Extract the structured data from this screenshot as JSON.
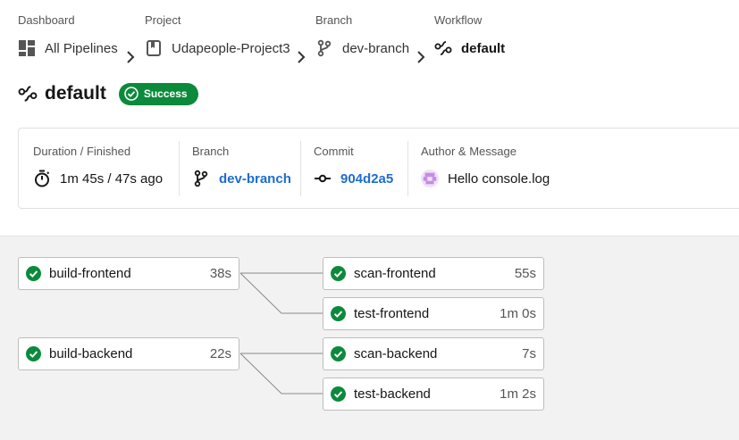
{
  "breadcrumb": {
    "dashboard": {
      "label": "Dashboard",
      "value": "All Pipelines"
    },
    "project": {
      "label": "Project",
      "value": "Udapeople-Project3"
    },
    "branch": {
      "label": "Branch",
      "value": "dev-branch"
    },
    "workflow": {
      "label": "Workflow",
      "value": "default"
    }
  },
  "title": {
    "name": "default",
    "status": "Success"
  },
  "info": {
    "duration": {
      "label": "Duration / Finished",
      "value": "1m 45s / 47s ago"
    },
    "branch": {
      "label": "Branch",
      "value": "dev-branch"
    },
    "commit": {
      "label": "Commit",
      "value": "904d2a5"
    },
    "author": {
      "label": "Author & Message",
      "value": "Hello console.log"
    }
  },
  "jobs": [
    {
      "name": "build-frontend",
      "duration": "38s",
      "status": "success"
    },
    {
      "name": "scan-frontend",
      "duration": "55s",
      "status": "success"
    },
    {
      "name": "test-frontend",
      "duration": "1m 0s",
      "status": "success"
    },
    {
      "name": "build-backend",
      "duration": "22s",
      "status": "success"
    },
    {
      "name": "scan-backend",
      "duration": "7s",
      "status": "success"
    },
    {
      "name": "test-backend",
      "duration": "1m 2s",
      "status": "success"
    }
  ],
  "colors": {
    "success": "#0c8a3c",
    "link": "#1d6dd1"
  },
  "icons": {
    "dashboard": "grid-icon",
    "project": "bookmark-icon",
    "branch": "git-branch-icon",
    "workflow": "workflow-icon",
    "duration": "stopwatch-icon",
    "commit": "git-commit-icon",
    "author": "avatar-icon",
    "status": "check-circle-icon"
  }
}
